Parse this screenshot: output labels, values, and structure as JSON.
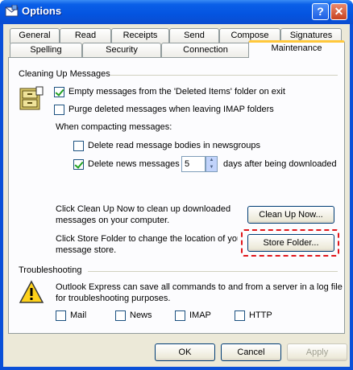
{
  "window": {
    "title": "Options",
    "help_label": "?",
    "close_label": "✕"
  },
  "tabs": {
    "row1": [
      "General",
      "Read",
      "Receipts",
      "Send",
      "Compose",
      "Signatures"
    ],
    "row2": [
      "Spelling",
      "Security",
      "Connection",
      "Maintenance"
    ],
    "active": "Maintenance"
  },
  "cleanup": {
    "heading": "Cleaning Up Messages",
    "empty_deleted": {
      "label": "Empty messages from the 'Deleted Items' folder on exit",
      "checked": true
    },
    "purge_imap": {
      "label": "Purge deleted messages when leaving IMAP folders",
      "checked": false
    },
    "compacting_label": "When compacting messages:",
    "delete_read_bodies": {
      "label": "Delete read message bodies in newsgroups",
      "checked": false
    },
    "delete_news": {
      "label": "Delete news messages",
      "checked": true,
      "days": "5",
      "suffix": "days after being downloaded"
    },
    "cleanup_text_1": "Click Clean Up Now to clean up downloaded",
    "cleanup_text_2": "messages on your computer.",
    "cleanup_button": "Clean Up Now...",
    "store_text_1": "Click Store Folder to change the location of your",
    "store_text_2": "message store.",
    "store_button": "Store Folder..."
  },
  "troubleshooting": {
    "heading": "Troubleshooting",
    "text_1": "Outlook Express can save all commands to and from a server in a log file",
    "text_2": "for troubleshooting purposes.",
    "options": [
      {
        "label": "Mail",
        "checked": false
      },
      {
        "label": "News",
        "checked": false
      },
      {
        "label": "IMAP",
        "checked": false
      },
      {
        "label": "HTTP",
        "checked": false
      }
    ]
  },
  "footer": {
    "ok": "OK",
    "cancel": "Cancel",
    "apply": "Apply"
  },
  "colors": {
    "highlight": "#e0161b",
    "titlebar": "#0a5fe8",
    "tab_accent": "#ffc83c"
  }
}
